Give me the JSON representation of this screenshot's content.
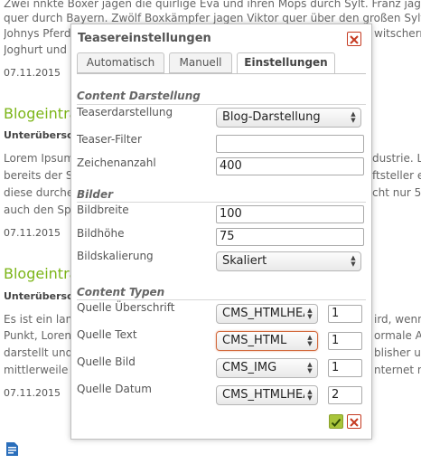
{
  "background": {
    "top_text_1": "Zwei nnkte Boxer jagen die quirlige Eva und ihren Mops durch Sylt. Franz jagt",
    "top_text_2": "quer durch Bayern. Zwölf Boxkämpfer jagen Viktor quer über den großen Sylter",
    "top_text_3": "Johnys Pferd",
    "top_text_3_right": "witschern",
    "top_text_4": "Joghurt und",
    "date_1": "07.11.2015",
    "title_2": "Blogeintra",
    "sub_2": "Unterübersch",
    "p2_l1": "Lorem Ipsum",
    "p2_l1_right": "dustrie. L",
    "p2_l2": "bereits der S",
    "p2_l2_right": "ftsteller e",
    "p2_l3": "diese durche",
    "p2_l3_right": "cht nur 5",
    "p2_l4": "auch den Sp",
    "date_2": "07.11.2015",
    "title_3": "Blogeintra",
    "sub_3": "Unterübersch",
    "p3_l1": "Es ist ein lan",
    "p3_l1_right": "ird, wenn",
    "p3_l2": "Punkt, Loren",
    "p3_l2_right": "ormale A",
    "p3_l3": "darstellt und",
    "p3_l3_right": "blisher u",
    "p3_l4": "mittlerweile",
    "p3_l4_right": "nternet n",
    "date_3": "07.11.2015",
    "edit_icon": "edit-document-icon"
  },
  "dialog": {
    "title": "Teasereinstellungen",
    "close_icon": "close-x-icon",
    "tabs": [
      {
        "label": "Automatisch"
      },
      {
        "label": "Manuell"
      },
      {
        "label": "Einstellungen"
      }
    ],
    "sections": {
      "content_darstellung": "Content Darstellung",
      "bilder": "Bilder",
      "content_typen": "Content Typen"
    },
    "fields": {
      "teaserdarstellung": {
        "label": "Teaserdarstellung",
        "value": "Blog-Darstellung"
      },
      "teaser_filter": {
        "label": "Teaser-Filter",
        "value": ""
      },
      "zeichenanzahl": {
        "label": "Zeichenanzahl",
        "value": "400"
      },
      "bildbreite": {
        "label": "Bildbreite",
        "value": "100"
      },
      "bildhoehe": {
        "label": "Bildhöhe",
        "value": "75"
      },
      "bildskalierung": {
        "label": "Bildskalierung",
        "value": "Skaliert"
      },
      "quelle_ueberschrift": {
        "label": "Quelle Überschrift",
        "value": "CMS_HTMLHEAD",
        "num": "1"
      },
      "quelle_text": {
        "label": "Quelle Text",
        "value": "CMS_HTML",
        "num": "1"
      },
      "quelle_bild": {
        "label": "Quelle Bild",
        "value": "CMS_IMG",
        "num": "1"
      },
      "quelle_datum": {
        "label": "Quelle Datum",
        "value": "CMS_HTMLHEAD",
        "num": "2"
      }
    },
    "ok_icon": "checkmark-icon",
    "cancel_icon": "cancel-x-icon",
    "colors": {
      "accent_green": "#7cb518",
      "close_red": "#c53b22",
      "ok_green": "#a8c43a"
    }
  }
}
